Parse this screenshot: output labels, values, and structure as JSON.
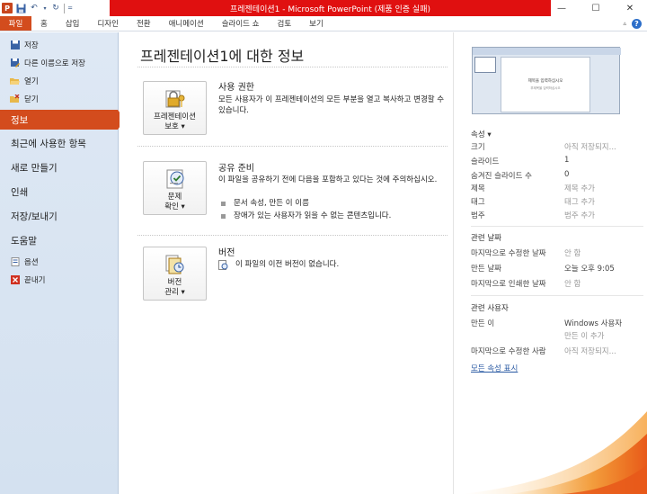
{
  "window": {
    "title": "프레젠테이션1 - Microsoft PowerPoint (제품 인증 실패)",
    "controls": [
      "minimize",
      "maximize",
      "close"
    ]
  },
  "quick_access": [
    "ppt-app-icon",
    "save-icon",
    "undo-icon",
    "redo-icon",
    "customize-icon"
  ],
  "ppt_logo": "P",
  "ribbon": {
    "tabs": [
      "파일",
      "홈",
      "삽입",
      "디자인",
      "전환",
      "애니메이션",
      "슬라이드 쇼",
      "검토",
      "보기"
    ]
  },
  "nav": {
    "top_items": [
      {
        "label": "저장",
        "icon": "save-icon"
      },
      {
        "label": "다른 이름으로 저장",
        "icon": "save-as-icon"
      },
      {
        "label": "열기",
        "icon": "folder-open-icon"
      },
      {
        "label": "닫기",
        "icon": "close-doc-icon"
      }
    ],
    "active": "정보",
    "big_items": [
      "최근에 사용한 항목",
      "새로 만들기",
      "인쇄",
      "저장/보내기",
      "도움말"
    ],
    "bottom_items": [
      {
        "label": "옵션",
        "icon": "options-icon"
      },
      {
        "label": "끝내기",
        "icon": "exit-icon"
      }
    ]
  },
  "main": {
    "title": "프레젠테이션1에 대한 정보",
    "sections": {
      "permissions": {
        "button_line1": "프레젠테이션",
        "button_line2": "보호 ▾",
        "title": "사용 권한",
        "desc": "모든 사용자가 이 프레젠테이션의 모든 부분을 열고 복사하고 변경할 수 있습니다."
      },
      "share": {
        "button_line1": "문제",
        "button_line2": "확인 ▾",
        "title": "공유 준비",
        "desc": "이 파일을 공유하기 전에 다음을 포함하고 있다는 것에 주의하십시오.",
        "bullets": [
          "문서 속성, 만든 이 이름",
          "장애가 있는 사용자가 읽을 수 없는 콘텐츠입니다."
        ]
      },
      "versions": {
        "button_line1": "버전",
        "button_line2": "관리 ▾",
        "title": "버전",
        "desc": "이 파일의 이전 버전이 없습니다."
      }
    }
  },
  "properties": {
    "thumbnail": {
      "title": "제목을 입력하십시오",
      "subtitle": "부제목을 입력하십시오"
    },
    "header": "속성 ▾",
    "rows": [
      {
        "k": "크기",
        "v": "아직 저장되지...",
        "muted": true
      },
      {
        "k": "슬라이드",
        "v": "1",
        "muted": false
      },
      {
        "k": "숨겨진 슬라이드 수",
        "v": "0",
        "muted": false
      },
      {
        "k": "제목",
        "v": "제목 추가",
        "muted": true
      },
      {
        "k": "태그",
        "v": "태그 추가",
        "muted": true
      },
      {
        "k": "범주",
        "v": "범주 추가",
        "muted": true
      }
    ],
    "dates_header": "관련 날짜",
    "dates": [
      {
        "k": "마지막으로 수정한 날짜",
        "v": "안 함",
        "muted": true
      },
      {
        "k": "만든 날짜",
        "v": "오늘 오후 9:05",
        "muted": false
      },
      {
        "k": "마지막으로 인쇄한 날짜",
        "v": "안 함",
        "muted": true
      }
    ],
    "people_header": "관련 사용자",
    "author_label": "만든 이",
    "author": "Windows 사용자",
    "add_author": "만든 이 추가",
    "modified_by_label": "마지막으로 수정한 사람",
    "modified_by": "아직 저장되지...",
    "show_all": "모든 속성 표시"
  },
  "colors": {
    "accent": "#d34c1d",
    "title_bar_red": "#e01010",
    "nav_bg": "#dee8f4",
    "link": "#2a5aa3"
  }
}
